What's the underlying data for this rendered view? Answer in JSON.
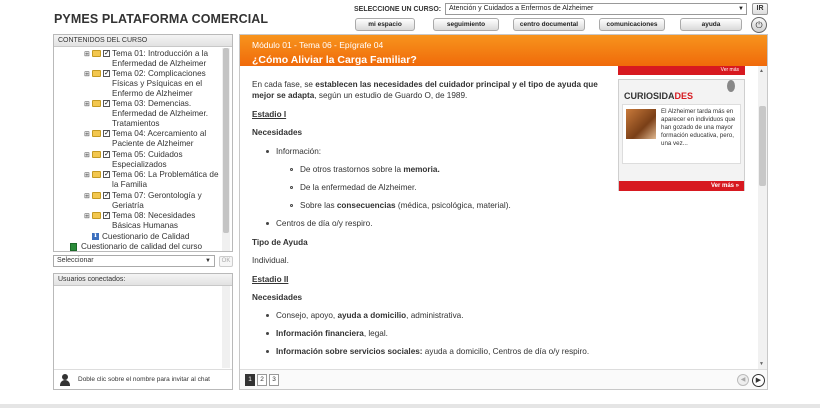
{
  "header": {
    "brand": "PYMES PLATAFORMA COMERCIAL",
    "course_select_label": "SELECCIONE UN CURSO:",
    "course_select_value": "Atención y Cuidados a Enfermos de Alzheimer",
    "ir_label": "IR",
    "nav": [
      "mi espacio",
      "seguimiento",
      "centro documental",
      "comunicaciones",
      "ayuda"
    ]
  },
  "sidebar": {
    "contents_title": "CONTENIDOS DEL CURSO",
    "items": [
      {
        "label": "Tema 01: Introducción a la Enfermedad de Alzheimer"
      },
      {
        "label": "Tema 02: Complicaciones Físicas y Psíquicas en el Enfermo de Alzheimer"
      },
      {
        "label": "Tema 03: Demencias. Enfermedad de Alzheimer. Tratamientos"
      },
      {
        "label": "Tema 04: Acercamiento al Paciente de Alzheimer"
      },
      {
        "label": "Tema 05: Cuidados Especializados"
      },
      {
        "label": "Tema 06: La Problemática de la Familia"
      },
      {
        "label": "Tema 07: Gerontología y Geriatría"
      },
      {
        "label": "Tema 08: Necesidades Básicas Humanas"
      }
    ],
    "quality_label": "Cuestionario de Calidad",
    "quality_course_label": "Cuestionario de calidad del curso",
    "select_value": "Seleccionar",
    "ok_label": "OK",
    "users_title": "Usuarios conectados:",
    "users_hint": "Doble clic sobre el nombre para invitar al chat"
  },
  "main": {
    "breadcrumb": "Módulo 01 - Tema 06 - Epígrafe 04",
    "title": "¿Cómo Aliviar la Carga Familiar?",
    "intro_pre": "En cada fase, se ",
    "intro_bold": "establecen las necesidades del cuidador principal y el tipo de ayuda que mejor se adapta",
    "intro_post": ", según un estudio de Guardo O, de 1989.",
    "stage1": "Estadio I",
    "needs": "Necesidades",
    "info_label": "Información:",
    "sub1_pre": "De otros trastornos sobre la ",
    "sub1_bold": "memoria.",
    "sub2": "De la enfermedad de Alzheimer.",
    "sub3_pre": "Sobre las ",
    "sub3_bold": "consecuencias",
    "sub3_post": " (médica, psicológica, material).",
    "day_centers": "Centros de día o/y respiro.",
    "help_type": "Tipo de Ayuda",
    "individual": "Individual.",
    "stage2": "Estadio II",
    "needs2": "Necesidades",
    "b1_pre": "Consejo, apoyo, ",
    "b1_bold": "ayuda a domicilio",
    "b1_post": ", administrativa.",
    "b2_bold": "Información financiera",
    "b2_post": ", legal.",
    "b3_bold": "Información sobre servicios sociales:",
    "b3_post": " ayuda a domicilio, Centros de día o/y respiro.",
    "pages": [
      "1",
      "2",
      "3"
    ]
  },
  "widget": {
    "top_more": "Ver más",
    "title_a": "CURIOSIDA",
    "title_b": "DES",
    "text": "El Alzheimer tarda más en aparecer en individuos que han gozado de una mayor formación educativa, pero, una vez...",
    "more": "Ver más »"
  },
  "colors": {
    "accent": "#f06a0a",
    "widget_red": "#d71920"
  }
}
